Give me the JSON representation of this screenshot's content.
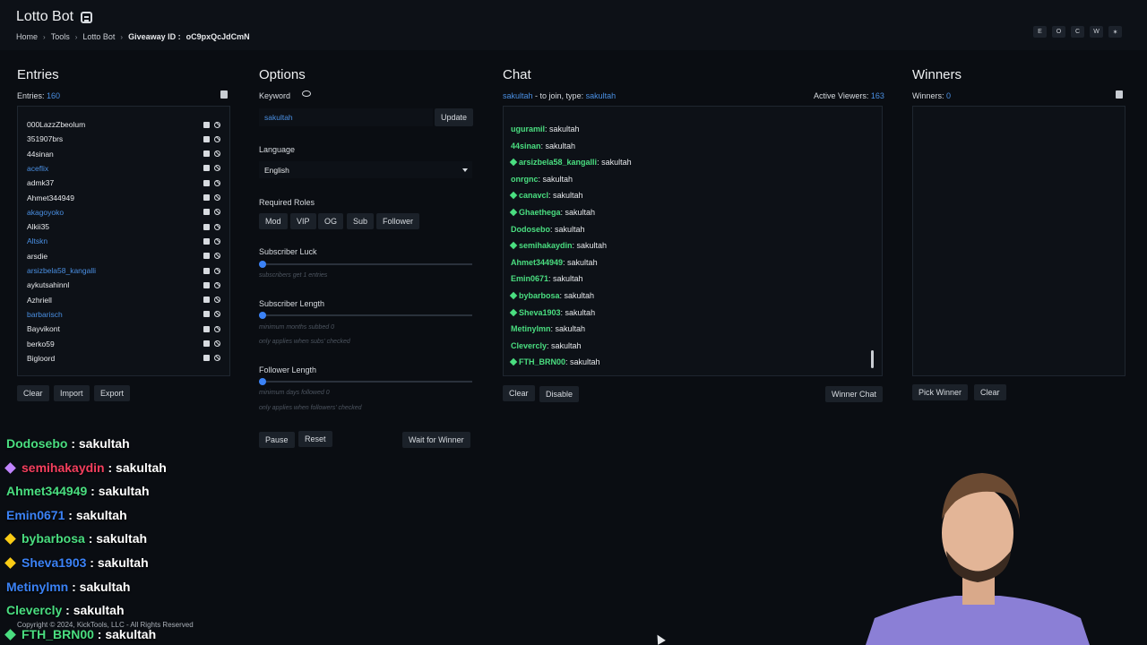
{
  "header": {
    "title": "Lotto Bot",
    "breadcrumbs": [
      "Home",
      "Tools",
      "Lotto Bot"
    ],
    "giveaway_label": "Giveaway ID :",
    "giveaway_id": "oC9pxQcJdCmN",
    "theme_buttons": [
      "E",
      "O",
      "C",
      "W",
      "✶"
    ]
  },
  "entries": {
    "title": "Entries",
    "count_label": "Entries:",
    "count": "160",
    "list": [
      {
        "name": "000LazzZbeolum",
        "color": "#e6e8eb"
      },
      {
        "name": "351907brs",
        "color": "#e6e8eb"
      },
      {
        "name": "44sinan",
        "color": "#e6e8eb"
      },
      {
        "name": "aceflix",
        "color": "#4a8fe2"
      },
      {
        "name": "admk37",
        "color": "#e6e8eb"
      },
      {
        "name": "Ahmet344949",
        "color": "#e6e8eb"
      },
      {
        "name": "akagoyoko",
        "color": "#4a8fe2"
      },
      {
        "name": "Alkii35",
        "color": "#e6e8eb"
      },
      {
        "name": "Altskn",
        "color": "#4a8fe2"
      },
      {
        "name": "arsdie",
        "color": "#e6e8eb"
      },
      {
        "name": "arsizbela58_kangalli",
        "color": "#4a8fe2"
      },
      {
        "name": "aykutsahinnl",
        "color": "#e6e8eb"
      },
      {
        "name": "Azhriell",
        "color": "#e6e8eb"
      },
      {
        "name": "barbarisch",
        "color": "#4a8fe2"
      },
      {
        "name": "Bayvikont",
        "color": "#e6e8eb"
      },
      {
        "name": "berko59",
        "color": "#e6e8eb"
      },
      {
        "name": "Bigloord",
        "color": "#e6e8eb"
      }
    ],
    "buttons": {
      "clear": "Clear",
      "import": "Import",
      "export": "Export"
    }
  },
  "options": {
    "title": "Options",
    "keyword_label": "Keyword",
    "keyword_value": "sakultah",
    "update_button": "Update",
    "language_label": "Language",
    "language_value": "English",
    "roles_label": "Required Roles",
    "roles": [
      "Mod",
      "VIP",
      "OG",
      "Sub",
      "Follower"
    ],
    "sub_luck_label": "Subscriber Luck",
    "sub_luck_hint_a": "subscribers get",
    "sub_luck_value": "1",
    "sub_luck_hint_b": "entries",
    "sub_length_label": "Subscriber Length",
    "sub_length_hint": "minimum months subbed",
    "sub_length_value": "0",
    "sub_length_note": "only applies when subs' checked",
    "follower_length_label": "Follower Length",
    "follower_length_hint": "minimum days followed",
    "follower_length_value": "0",
    "follower_length_note": "only applies when followers' checked",
    "pause_button": "Pause",
    "reset_button": "Reset",
    "wait_button": "Wait for Winner"
  },
  "chat": {
    "title": "Chat",
    "channel": "sakultah",
    "join_text": "- to join, type:",
    "join_keyword": "sakultah",
    "viewers_label": "Active Viewers:",
    "viewers": "163",
    "messages": [
      {
        "user": "uguramil",
        "msg": "sakultah",
        "color": "#4ade80",
        "badge": false
      },
      {
        "user": "44sinan",
        "msg": "sakultah",
        "color": "#4ade80",
        "badge": false
      },
      {
        "user": "arsizbela58_kangalli",
        "msg": "sakultah",
        "color": "#4ade80",
        "badge": true
      },
      {
        "user": "onrgnc",
        "msg": "sakultah",
        "color": "#4ade80",
        "badge": false
      },
      {
        "user": "canavcl",
        "msg": "sakultah",
        "color": "#4ade80",
        "badge": true
      },
      {
        "user": "Ghaethega",
        "msg": "sakultah",
        "color": "#4ade80",
        "badge": true
      },
      {
        "user": "Dodosebo",
        "msg": "sakultah",
        "color": "#4ade80",
        "badge": false
      },
      {
        "user": "semihakaydin",
        "msg": "sakultah",
        "color": "#4ade80",
        "badge": true
      },
      {
        "user": "Ahmet344949",
        "msg": "sakultah",
        "color": "#4ade80",
        "badge": false
      },
      {
        "user": "Emin0671",
        "msg": "sakultah",
        "color": "#4ade80",
        "badge": false
      },
      {
        "user": "bybarbosa",
        "msg": "sakultah",
        "color": "#4ade80",
        "badge": true
      },
      {
        "user": "Sheva1903",
        "msg": "sakultah",
        "color": "#4ade80",
        "badge": true
      },
      {
        "user": "Metinylmn",
        "msg": "sakultah",
        "color": "#4ade80",
        "badge": false
      },
      {
        "user": "Clevercly",
        "msg": "sakultah",
        "color": "#4ade80",
        "badge": false
      },
      {
        "user": "FTH_BRN00",
        "msg": "sakultah",
        "color": "#4ade80",
        "badge": true
      }
    ],
    "clear_button": "Clear",
    "disable_button": "Disable",
    "winner_chat_button": "Winner Chat"
  },
  "winners": {
    "title": "Winners",
    "count_label": "Winners:",
    "count": "0",
    "pick_button": "Pick Winner",
    "clear_button": "Clear"
  },
  "overlay": {
    "lines": [
      {
        "user": "Dodosebo",
        "msg": ": sakultah",
        "color": "#4ade80",
        "gem": ""
      },
      {
        "user": "semihakaydin",
        "msg": ": sakultah",
        "color": "#f43f5e",
        "gem": "#c084fc"
      },
      {
        "user": "Ahmet344949",
        "msg": ": sakultah",
        "color": "#4ade80",
        "gem": ""
      },
      {
        "user": "Emin0671",
        "msg": ": sakultah",
        "color": "#3b82f6",
        "gem": ""
      },
      {
        "user": "bybarbosa",
        "msg": ": sakultah",
        "color": "#4ade80",
        "gem": "#facc15"
      },
      {
        "user": "Sheva1903",
        "msg": ": sakultah",
        "color": "#3b82f6",
        "gem": "#facc15"
      },
      {
        "user": "Metinylmn",
        "msg": ": sakultah",
        "color": "#3b82f6",
        "gem": ""
      },
      {
        "user": "Clevercly",
        "msg": ": sakultah",
        "color": "#4ade80",
        "gem": ""
      },
      {
        "user": "FTH_BRN00",
        "msg": ": sakultah",
        "color": "#4ade80",
        "gem": "#4ade80"
      }
    ]
  },
  "footer": {
    "copyright": "Copyright © 2024, KickTools, LLC - All Rights Reserved"
  }
}
